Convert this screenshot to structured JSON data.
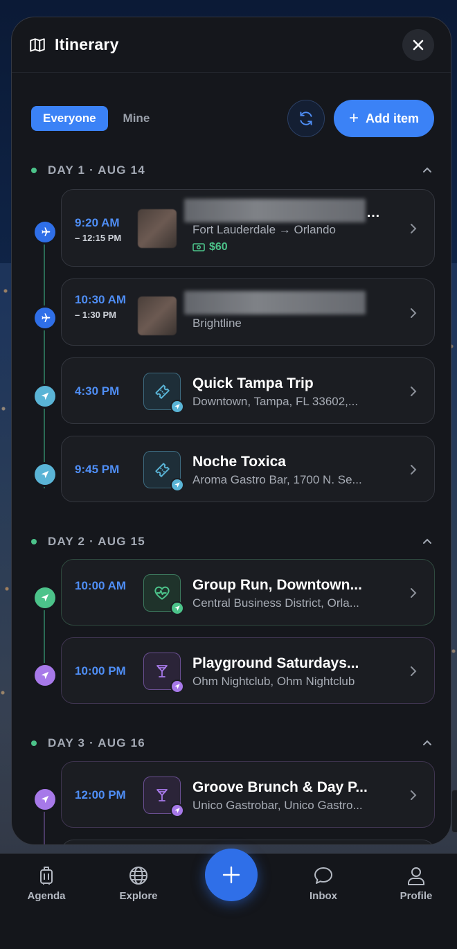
{
  "header": {
    "title": "Itinerary"
  },
  "filters": {
    "everyone": "Everyone",
    "mine": "Mine"
  },
  "toolbar": {
    "add_label": "Add item"
  },
  "days": [
    {
      "label": "DAY 1 · AUG 14"
    },
    {
      "label": "DAY 2 · AUG 15"
    },
    {
      "label": "DAY 3 · AUG 16"
    }
  ],
  "items": [
    {
      "time": "9:20 AM",
      "time_end": "– 12:15 PM",
      "subtitle": "Fort Lauderdale → Orlando",
      "price": "$60",
      "kind": "flight"
    },
    {
      "time": "10:30 AM",
      "time_end": "– 1:30 PM",
      "subtitle": "Brightline",
      "kind": "flight"
    },
    {
      "time": "4:30 PM",
      "title": "Quick Tampa Trip",
      "subtitle": "Downtown, Tampa, FL 33602,...",
      "kind": "ticket"
    },
    {
      "time": "9:45 PM",
      "title": "Noche Toxica",
      "subtitle": "Aroma Gastro Bar, 1700 N. Se...",
      "kind": "ticket"
    },
    {
      "time": "10:00 AM",
      "title": "Group Run, Downtown...",
      "subtitle": "Central Business District, Orla...",
      "kind": "fitness"
    },
    {
      "time": "10:00 PM",
      "title": "Playground Saturdays...",
      "subtitle": "Ohm Nightclub, Ohm Nightclub",
      "kind": "nightlife"
    },
    {
      "time": "12:00 PM",
      "title": "Groove Brunch & Day P...",
      "subtitle": "Unico Gastrobar, Unico Gastro...",
      "kind": "nightlife"
    }
  ],
  "nav": {
    "agenda": "Agenda",
    "explore": "Explore",
    "inbox": "Inbox",
    "profile": "Profile"
  },
  "colors": {
    "accent": "#3b82f6",
    "green": "#4cc38a",
    "teal": "#5ab4d6",
    "purple": "#a779e9",
    "panel": "#15171c"
  },
  "icons": [
    "map-icon",
    "close-icon",
    "refresh-icon",
    "plus-icon",
    "chevron-up-icon",
    "airplane-icon",
    "navigation-arrow-icon",
    "ticket-icon",
    "heart-pulse-icon",
    "cocktail-icon",
    "cash-icon",
    "chevron-right-icon",
    "luggage-icon",
    "globe-icon",
    "chat-bubble-icon",
    "person-icon"
  ]
}
